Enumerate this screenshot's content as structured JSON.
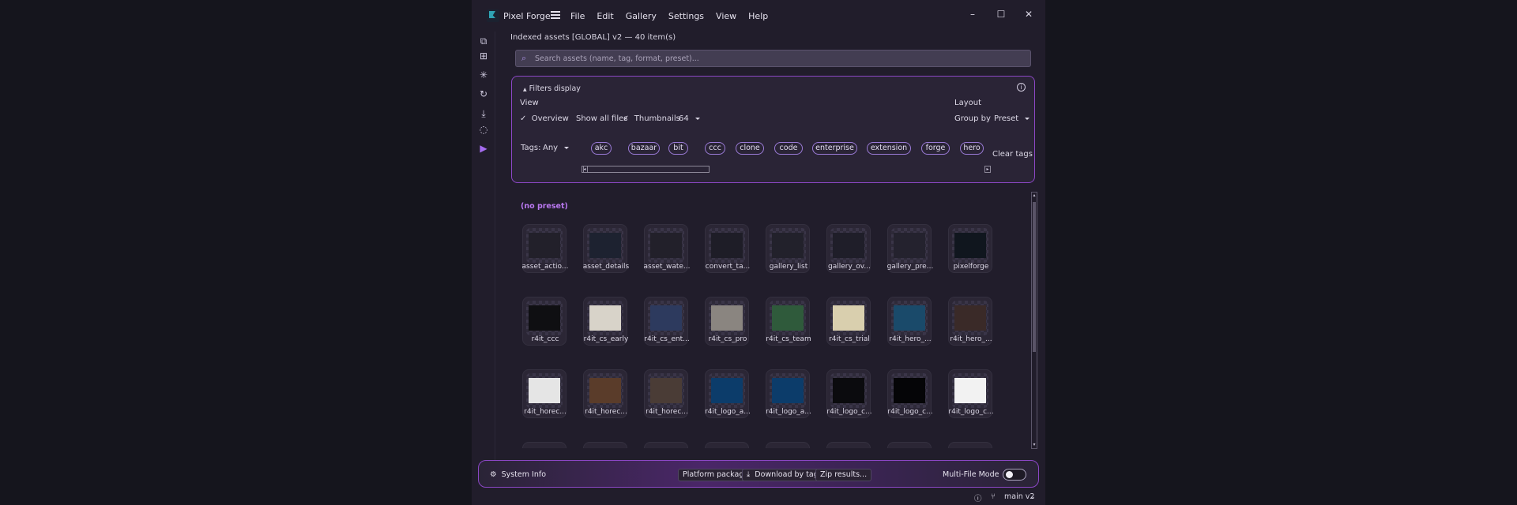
{
  "app": {
    "title": "Pixel Forge"
  },
  "menu": [
    "File",
    "Edit",
    "Gallery",
    "Settings",
    "View",
    "Help"
  ],
  "window_controls": {
    "minimize": "–",
    "maximize": "☐",
    "close": "✕"
  },
  "rail_icons": [
    "layers-icon",
    "grid-icon",
    "sparkle-icon",
    "refresh-icon",
    "download-icon",
    "lasso-icon",
    "play-icon"
  ],
  "status": "Indexed assets [GLOBAL] v2 — 40 item(s)",
  "search": {
    "placeholder": "Search assets (name, tag, format, preset)...",
    "value": ""
  },
  "filters": {
    "header": "Filters display",
    "view_label": "View",
    "overview_check": "✓",
    "overview": "Overview",
    "show_all": "Show all files",
    "thumbnails_check": "✓",
    "thumbnails": "Thumbnails",
    "thumb_size": "64",
    "layout_label": "Layout",
    "group_by_label": "Group by",
    "group_by_value": "Preset",
    "tags_label": "Tags:",
    "tags_mode": "Any",
    "tags": [
      "akc",
      "bazaar",
      "bit",
      "ccc",
      "clone",
      "code",
      "enterprise",
      "extension",
      "forge",
      "hero"
    ],
    "clear_tags": "Clear tags"
  },
  "gallery": {
    "group_title": "(no preset)",
    "rows": [
      [
        "asset_actio...",
        "asset_details",
        "asset_wate...",
        "convert_ta...",
        "gallery_list",
        "gallery_ov...",
        "gallery_pre...",
        "pixelforge"
      ],
      [
        "r4it_ccc",
        "r4it_cs_early",
        "r4it_cs_ent...",
        "r4it_cs_pro",
        "r4it_cs_team",
        "r4it_cs_trial",
        "r4it_hero_...",
        "r4it_hero_..."
      ],
      [
        "r4it_horec...",
        "r4it_horec...",
        "r4it_horec...",
        "r4it_logo_a...",
        "r4it_logo_a...",
        "r4it_logo_c...",
        "r4it_logo_c...",
        "r4it_logo_c..."
      ]
    ]
  },
  "bottom": {
    "system_info": "System Info",
    "platform": "Platform package...",
    "download_tags": "Download by tags...",
    "zip": "Zip results...",
    "multi_file": "Multi-File Mode",
    "multi_file_on": false
  },
  "footer": {
    "branch": "main v2"
  },
  "colors": {
    "accent": "#8c47c6",
    "group_title": "#b978f0",
    "background": "#211d2b"
  }
}
